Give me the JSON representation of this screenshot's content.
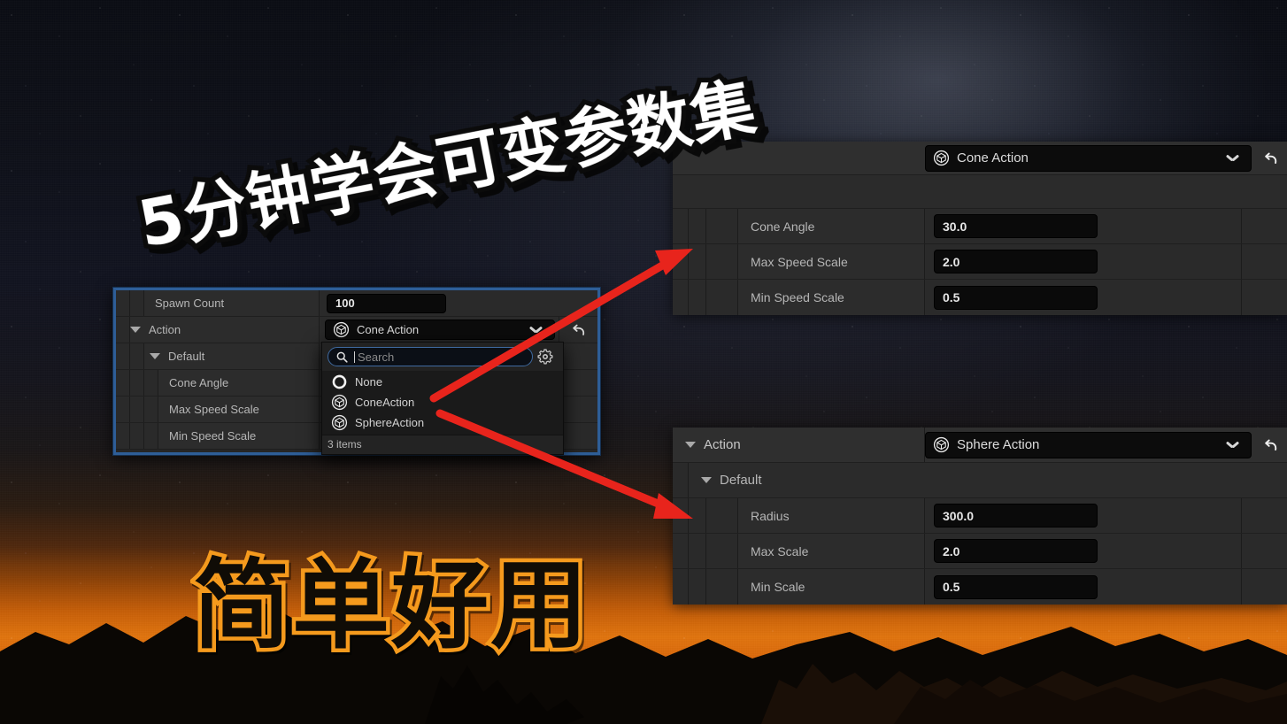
{
  "overlay_titles": {
    "top": "5分钟学会可变参数集",
    "bottom": "简单好用"
  },
  "left_panel": {
    "rows": [
      {
        "label": "Spawn Count",
        "value": "100",
        "kind": "number",
        "indent": 1
      },
      {
        "label": "Action",
        "value": "Cone Action",
        "kind": "combo",
        "indent": 0,
        "expanded": true
      },
      {
        "label": "Default",
        "value": "",
        "kind": "category",
        "indent": 1,
        "expanded": true
      },
      {
        "label": "Cone Angle",
        "value": "",
        "kind": "number",
        "indent": 3
      },
      {
        "label": "Max Speed Scale",
        "value": "",
        "kind": "number",
        "indent": 3
      },
      {
        "label": "Min Speed Scale",
        "value": "",
        "kind": "number",
        "indent": 3
      }
    ],
    "dropdown": {
      "search_placeholder": "Search",
      "search_value": "",
      "search_icon": "search-icon",
      "settings_icon": "gear-icon",
      "items": [
        {
          "label": "None",
          "icon": "empty-ring-icon"
        },
        {
          "label": "ConeAction",
          "icon": "cube-class-icon"
        },
        {
          "label": "SphereAction",
          "icon": "cube-class-icon"
        }
      ],
      "footer": "3 items"
    },
    "reset_icon": "reset-arrow-icon"
  },
  "top_right_panel": {
    "combo": {
      "label": "Cone Action",
      "icon": "cube-class-icon",
      "chevron": "chevron-down-icon"
    },
    "reset_icon": "reset-arrow-icon",
    "properties": [
      {
        "label": "Cone Angle",
        "value": "30.0"
      },
      {
        "label": "Max Speed Scale",
        "value": "2.0"
      },
      {
        "label": "Min Speed Scale",
        "value": "0.5"
      }
    ]
  },
  "bottom_right_panel": {
    "header": {
      "label": "Action",
      "expanded": true
    },
    "category": {
      "label": "Default",
      "expanded": true
    },
    "combo": {
      "label": "Sphere Action",
      "icon": "cube-class-icon",
      "chevron": "chevron-down-icon"
    },
    "reset_icon": "reset-arrow-icon",
    "properties": [
      {
        "label": "Radius",
        "value": "300.0"
      },
      {
        "label": "Max Scale",
        "value": "2.0"
      },
      {
        "label": "Min Scale",
        "value": "0.5"
      }
    ]
  },
  "annotations": {
    "arrow_color": "#e8241c",
    "arrows": [
      {
        "name": "arrow-cone",
        "from": "ConeAction option",
        "to": "Cone Action panel"
      },
      {
        "name": "arrow-sphere",
        "from": "SphereAction option",
        "to": "Sphere Action panel"
      }
    ]
  },
  "colors": {
    "selection_blue": "#2e5e97",
    "accent_orange": "#f59a1d",
    "panel_bg": "#262626",
    "field_bg": "#0a0a0a"
  }
}
